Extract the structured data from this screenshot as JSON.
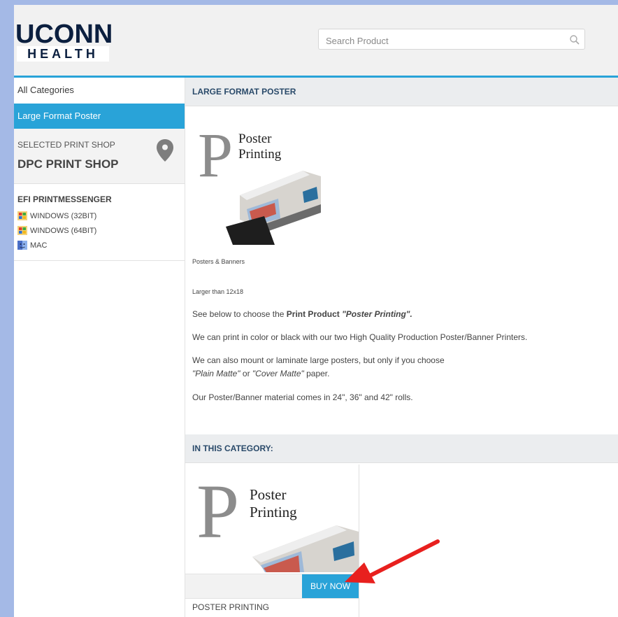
{
  "header": {
    "logo_top": "UCONN",
    "logo_bottom": "HEALTH",
    "search_placeholder": "Search Product"
  },
  "sidebar": {
    "all_categories": "All Categories",
    "active_category": "Large Format Poster",
    "selected_shop_label": "SELECTED PRINT SHOP",
    "selected_shop_name": "DPC PRINT SHOP",
    "efi_title": "EFI PRINTMESSENGER",
    "downloads": [
      {
        "label": "WINDOWS (32BIT)",
        "icon": "windows-icon"
      },
      {
        "label": "WINDOWS (64BIT)",
        "icon": "windows-icon"
      },
      {
        "label": "MAC",
        "icon": "mac-icon"
      }
    ]
  },
  "main": {
    "section_title": "LARGE FORMAT POSTER",
    "image_caption_line1": "Poster",
    "image_caption_line2": "Printing",
    "image_letter": "P",
    "subtitle": "Posters & Banners",
    "size_note": "Larger than 12x18",
    "intro_prefix": "See below to choose the ",
    "intro_bold": "Print Product ",
    "intro_italic": "\"Poster Printing\".",
    "line2": "We can print in color or black with our two High Quality Production Poster/Banner Printers.",
    "line3": "We can also mount or laminate large posters, but only if you choose",
    "line4_italic1": "\"Plain Matte\"",
    "line4_mid": " or ",
    "line4_italic2": "\"Cover Matte\"",
    "line4_end": " paper.",
    "line5": "Our Poster/Banner material comes in 24\", 36\" and 42\" rolls.",
    "category_title": "IN THIS CATEGORY:",
    "card": {
      "buy_label": "BUY NOW",
      "title": "POSTER PRINTING"
    }
  },
  "colors": {
    "accent": "#29a3d8",
    "background": "#a4b9e6",
    "arrow": "#e8201e"
  }
}
